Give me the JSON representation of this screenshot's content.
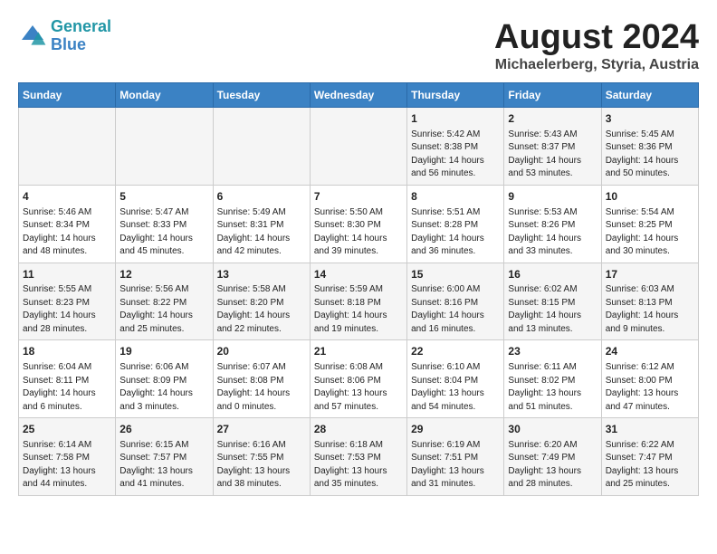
{
  "header": {
    "logo_line1": "General",
    "logo_line2": "Blue",
    "month": "August 2024",
    "location": "Michaelerberg, Styria, Austria"
  },
  "weekdays": [
    "Sunday",
    "Monday",
    "Tuesday",
    "Wednesday",
    "Thursday",
    "Friday",
    "Saturday"
  ],
  "weeks": [
    [
      {
        "day": "",
        "content": ""
      },
      {
        "day": "",
        "content": ""
      },
      {
        "day": "",
        "content": ""
      },
      {
        "day": "",
        "content": ""
      },
      {
        "day": "1",
        "content": "Sunrise: 5:42 AM\nSunset: 8:38 PM\nDaylight: 14 hours\nand 56 minutes."
      },
      {
        "day": "2",
        "content": "Sunrise: 5:43 AM\nSunset: 8:37 PM\nDaylight: 14 hours\nand 53 minutes."
      },
      {
        "day": "3",
        "content": "Sunrise: 5:45 AM\nSunset: 8:36 PM\nDaylight: 14 hours\nand 50 minutes."
      }
    ],
    [
      {
        "day": "4",
        "content": "Sunrise: 5:46 AM\nSunset: 8:34 PM\nDaylight: 14 hours\nand 48 minutes."
      },
      {
        "day": "5",
        "content": "Sunrise: 5:47 AM\nSunset: 8:33 PM\nDaylight: 14 hours\nand 45 minutes."
      },
      {
        "day": "6",
        "content": "Sunrise: 5:49 AM\nSunset: 8:31 PM\nDaylight: 14 hours\nand 42 minutes."
      },
      {
        "day": "7",
        "content": "Sunrise: 5:50 AM\nSunset: 8:30 PM\nDaylight: 14 hours\nand 39 minutes."
      },
      {
        "day": "8",
        "content": "Sunrise: 5:51 AM\nSunset: 8:28 PM\nDaylight: 14 hours\nand 36 minutes."
      },
      {
        "day": "9",
        "content": "Sunrise: 5:53 AM\nSunset: 8:26 PM\nDaylight: 14 hours\nand 33 minutes."
      },
      {
        "day": "10",
        "content": "Sunrise: 5:54 AM\nSunset: 8:25 PM\nDaylight: 14 hours\nand 30 minutes."
      }
    ],
    [
      {
        "day": "11",
        "content": "Sunrise: 5:55 AM\nSunset: 8:23 PM\nDaylight: 14 hours\nand 28 minutes."
      },
      {
        "day": "12",
        "content": "Sunrise: 5:56 AM\nSunset: 8:22 PM\nDaylight: 14 hours\nand 25 minutes."
      },
      {
        "day": "13",
        "content": "Sunrise: 5:58 AM\nSunset: 8:20 PM\nDaylight: 14 hours\nand 22 minutes."
      },
      {
        "day": "14",
        "content": "Sunrise: 5:59 AM\nSunset: 8:18 PM\nDaylight: 14 hours\nand 19 minutes."
      },
      {
        "day": "15",
        "content": "Sunrise: 6:00 AM\nSunset: 8:16 PM\nDaylight: 14 hours\nand 16 minutes."
      },
      {
        "day": "16",
        "content": "Sunrise: 6:02 AM\nSunset: 8:15 PM\nDaylight: 14 hours\nand 13 minutes."
      },
      {
        "day": "17",
        "content": "Sunrise: 6:03 AM\nSunset: 8:13 PM\nDaylight: 14 hours\nand 9 minutes."
      }
    ],
    [
      {
        "day": "18",
        "content": "Sunrise: 6:04 AM\nSunset: 8:11 PM\nDaylight: 14 hours\nand 6 minutes."
      },
      {
        "day": "19",
        "content": "Sunrise: 6:06 AM\nSunset: 8:09 PM\nDaylight: 14 hours\nand 3 minutes."
      },
      {
        "day": "20",
        "content": "Sunrise: 6:07 AM\nSunset: 8:08 PM\nDaylight: 14 hours\nand 0 minutes."
      },
      {
        "day": "21",
        "content": "Sunrise: 6:08 AM\nSunset: 8:06 PM\nDaylight: 13 hours\nand 57 minutes."
      },
      {
        "day": "22",
        "content": "Sunrise: 6:10 AM\nSunset: 8:04 PM\nDaylight: 13 hours\nand 54 minutes."
      },
      {
        "day": "23",
        "content": "Sunrise: 6:11 AM\nSunset: 8:02 PM\nDaylight: 13 hours\nand 51 minutes."
      },
      {
        "day": "24",
        "content": "Sunrise: 6:12 AM\nSunset: 8:00 PM\nDaylight: 13 hours\nand 47 minutes."
      }
    ],
    [
      {
        "day": "25",
        "content": "Sunrise: 6:14 AM\nSunset: 7:58 PM\nDaylight: 13 hours\nand 44 minutes."
      },
      {
        "day": "26",
        "content": "Sunrise: 6:15 AM\nSunset: 7:57 PM\nDaylight: 13 hours\nand 41 minutes."
      },
      {
        "day": "27",
        "content": "Sunrise: 6:16 AM\nSunset: 7:55 PM\nDaylight: 13 hours\nand 38 minutes."
      },
      {
        "day": "28",
        "content": "Sunrise: 6:18 AM\nSunset: 7:53 PM\nDaylight: 13 hours\nand 35 minutes."
      },
      {
        "day": "29",
        "content": "Sunrise: 6:19 AM\nSunset: 7:51 PM\nDaylight: 13 hours\nand 31 minutes."
      },
      {
        "day": "30",
        "content": "Sunrise: 6:20 AM\nSunset: 7:49 PM\nDaylight: 13 hours\nand 28 minutes."
      },
      {
        "day": "31",
        "content": "Sunrise: 6:22 AM\nSunset: 7:47 PM\nDaylight: 13 hours\nand 25 minutes."
      }
    ]
  ]
}
